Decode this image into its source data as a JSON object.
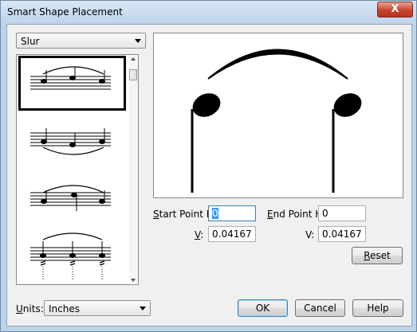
{
  "window": {
    "title": "Smart Shape Placement",
    "close_glyph": "X"
  },
  "shape_select": {
    "value": "Slur"
  },
  "shape_list": {
    "items": [
      "slur-over",
      "slur-under",
      "slur-over-variant",
      "slur-over-tremolo"
    ],
    "selected_index": 0
  },
  "start_point": {
    "h_label_key": "S",
    "h_label_rest": "tart Point H:",
    "h_value": "0",
    "v_label_key": "V",
    "v_label_rest": ":",
    "v_value": "0.04167"
  },
  "end_point": {
    "h_label_key": "E",
    "h_label_rest": "nd Point H:",
    "h_value": "0",
    "v_label": "V:",
    "v_value": "0.04167"
  },
  "buttons": {
    "reset_key": "R",
    "reset_rest": "eset",
    "ok": "OK",
    "cancel": "Cancel",
    "help": "Help"
  },
  "units": {
    "label_key": "U",
    "label_rest": "nits:",
    "value": "Inches"
  }
}
